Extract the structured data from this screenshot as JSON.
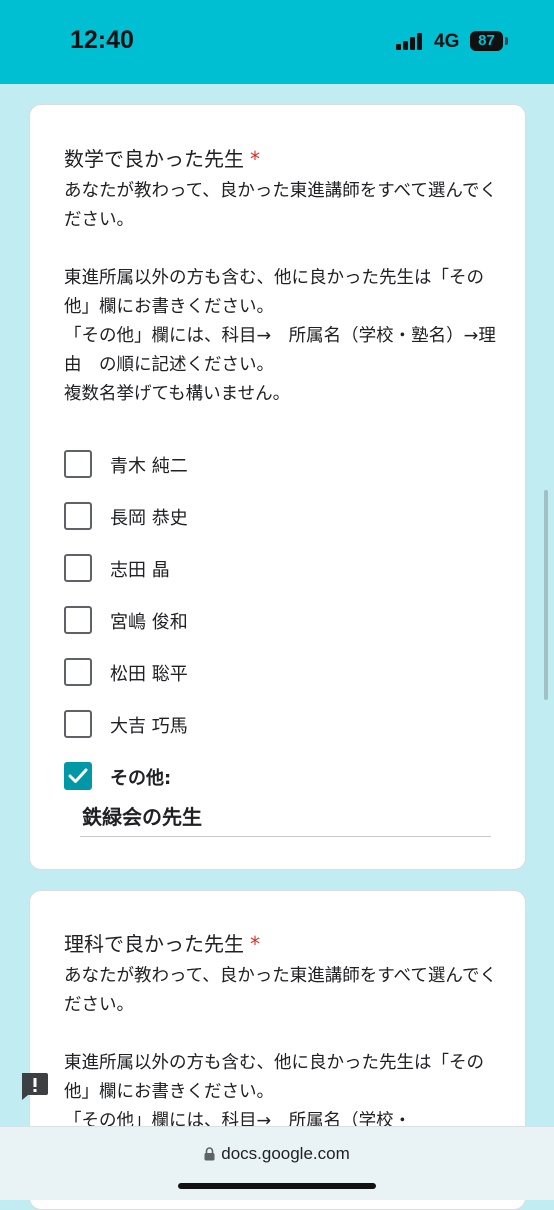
{
  "status_bar": {
    "time": "12:40",
    "network": "4G",
    "battery": "87"
  },
  "question1": {
    "title": "数学で良かった先生",
    "required_mark": "*",
    "description": "あなたが教わって、良かった東進講師をすべて選んでください。\n\n東進所属以外の方も含む、他に良かった先生は「その他」欄にお書きください。\n「その他」欄には、科目→　所属名（学校・塾名）→理由　の順に記述ください。\n複数名挙げても構いません。",
    "options": [
      {
        "label": "青木 純二",
        "checked": false
      },
      {
        "label": "長岡 恭史",
        "checked": false
      },
      {
        "label": "志田 晶",
        "checked": false
      },
      {
        "label": "宮嶋 俊和",
        "checked": false
      },
      {
        "label": "松田 聡平",
        "checked": false
      },
      {
        "label": "大吉 巧馬",
        "checked": false
      }
    ],
    "other_label": "その他:",
    "other_checked": true,
    "other_value": "鉄緑会の先生"
  },
  "question2": {
    "title": "理科で良かった先生",
    "required_mark": "*",
    "description": "あなたが教わって、良かった東進講師をすべて選んでください。\n\n東進所属以外の方も含む、他に良かった先生は「その他」欄にお書きください。\n「その他」欄には、科目→　所属名（学校・"
  },
  "browser": {
    "url": "docs.google.com"
  },
  "colors": {
    "accent": "#0097a7",
    "status_bar": "#00bfd3",
    "background": "#c0ecf2",
    "required": "#d93025"
  },
  "icons": {
    "lock": "lock-icon",
    "report": "report-icon",
    "check": "check-icon"
  }
}
